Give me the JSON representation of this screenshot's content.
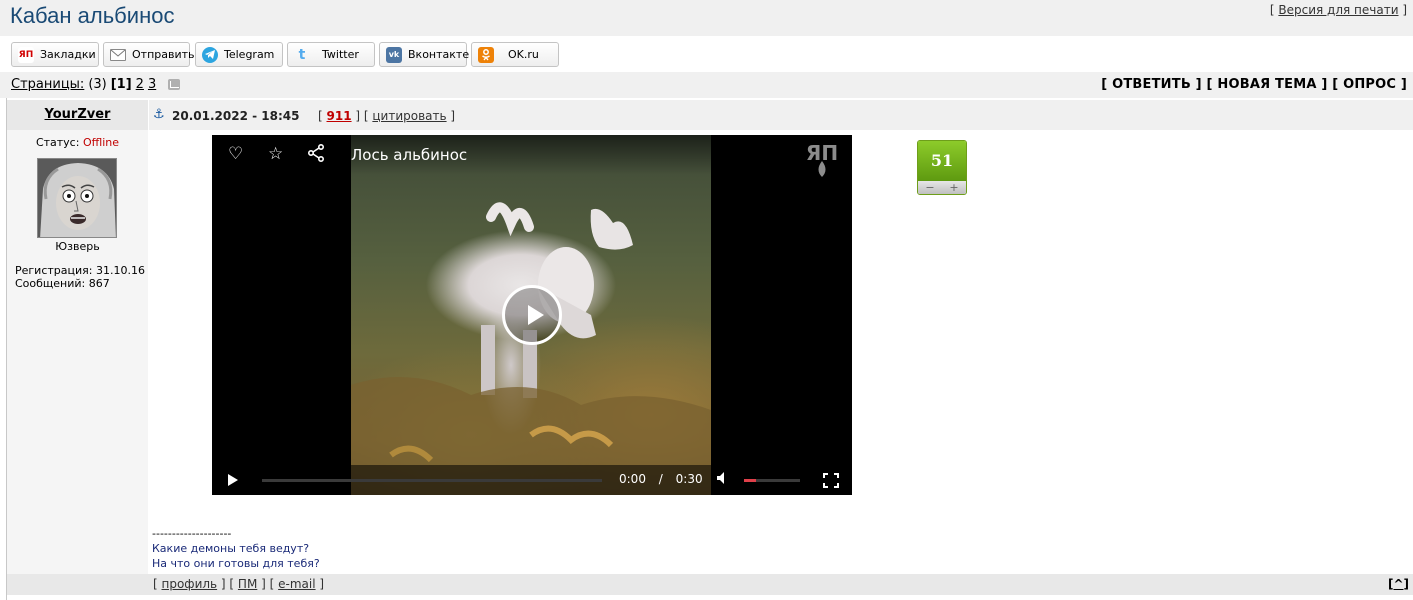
{
  "page": {
    "title": "Кабан альбинос",
    "print_prefix": "[ ",
    "print_link": "Версия для печати",
    "print_suffix": " ]"
  },
  "share": {
    "buttons": [
      {
        "label": "Закладки",
        "icon": "yap-icon",
        "color": "#ffffff"
      },
      {
        "label": "Отправить",
        "icon": "mail-icon",
        "color": "#ffffff"
      },
      {
        "label": "Telegram",
        "icon": "telegram-icon",
        "color": "#2ca5e0"
      },
      {
        "label": "Twitter",
        "icon": "twitter-icon",
        "color": "#55acee"
      },
      {
        "label": "Вконтакте",
        "icon": "vk-icon",
        "color": "#4c75a3"
      },
      {
        "label": "OK.ru",
        "icon": "ok-icon",
        "color": "#ee8208"
      }
    ]
  },
  "pagination": {
    "label": "Страницы:",
    "count": "(3)",
    "current": "[1]",
    "page2": "2",
    "page3": "3"
  },
  "actions": {
    "reply": "[ ОТВЕТИТЬ ]",
    "new_topic": "[ НОВАЯ ТЕМА ]",
    "poll": "[ ОПРОС ]"
  },
  "post": {
    "author": "YourZver",
    "status_label": "Статус:",
    "status_value": "Offline",
    "avatar_caption": "Юзверь",
    "registration": "Регистрация: 31.10.16",
    "messages": "Сообщений: 867",
    "date": "20.01.2022 - 18:45",
    "number": "911",
    "quote": "цитировать",
    "rating": "51",
    "rating_minus": "−",
    "rating_plus": "+",
    "signature_divider": "--------------------",
    "signature_line1": "Какие демоны тебя ведут?",
    "signature_line2": "На что они готовы для тебя?"
  },
  "video": {
    "title": "Лось альбинос",
    "logo": "ЯП",
    "time_current": "0:00",
    "time_separator": "/",
    "time_total": "0:30",
    "volume_level": 0.22
  },
  "footer": {
    "profile": "профиль",
    "pm": "ПМ",
    "email": "e-mail",
    "top": "^"
  },
  "colors": {
    "title": "#1a4a75",
    "offline": "#c00000",
    "rating_green": "#6aab16",
    "signature": "#1a2a78"
  }
}
